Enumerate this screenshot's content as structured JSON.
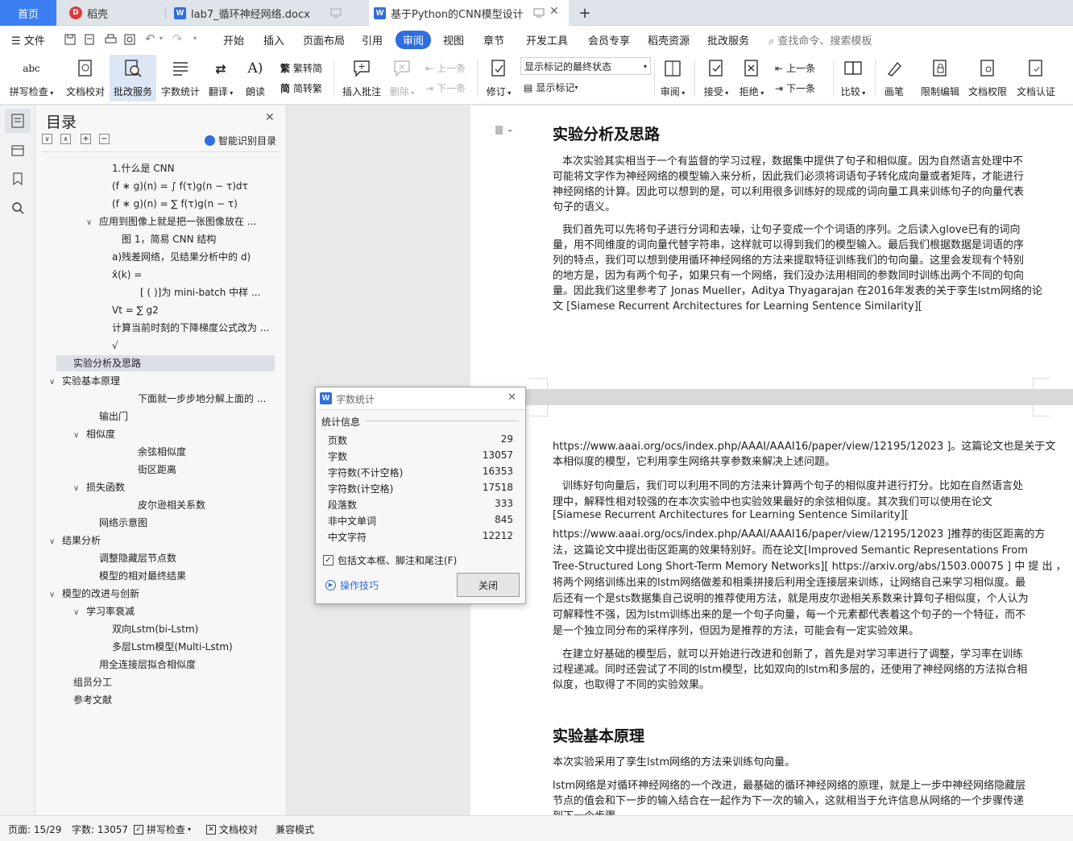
{
  "tabs": {
    "home": "首页",
    "daoke": "稻壳",
    "doc1": "lab7_循环神经网络.docx",
    "doc2": "基于Python的CNN模型设计",
    "add": "+"
  },
  "menu": {
    "file": "文件",
    "items": [
      "开始",
      "插入",
      "页面布局",
      "引用",
      "审阅",
      "视图",
      "章节",
      "开发工具",
      "会员专享",
      "稻壳资源",
      "批改服务"
    ],
    "active": "审阅",
    "search": "查找命令、搜索模板"
  },
  "toolbar": {
    "spell": "拼写检查",
    "proof": "文档校对",
    "grade": "批改服务",
    "count": "字数统计",
    "translate": "翻译",
    "read": "朗读",
    "to_trad": "繁转简",
    "to_simp": "简转繁",
    "insert_comment": "插入批注",
    "delete": "删除",
    "prev_comment": "上一条",
    "next_comment": "下一条",
    "revise": "修订",
    "markup_state": "显示标记的最终状态",
    "show_markup": "显示标记",
    "review": "审阅",
    "accept": "接受",
    "reject": "拒绝",
    "prev_change": "上一条",
    "next_change": "下一条",
    "compare": "比较",
    "pen": "画笔",
    "restrict": "限制编辑",
    "doc_perm": "文档权限",
    "doc_cert": "文档认证",
    "ic_abc": "abc"
  },
  "nav": {
    "title": "目录",
    "smart": "智能识别目录",
    "items": [
      {
        "text": "1.什么是 CNN",
        "arrow": ""
      },
      {
        "text": "(f ∗ g)(n) = ∫ f(τ)g(n − τ)dτ",
        "arrow": ""
      },
      {
        "text": "(f ∗ g)(n) = ∑ f(τ)g(n − τ)",
        "arrow": ""
      },
      {
        "text": "应用到图像上就是把一张图像放在 ...",
        "arrow": "∨"
      },
      {
        "text": "图 1，简易 CNN 结构",
        "arrow": ""
      },
      {
        "text": "a)残差网络，见结果分析中的 d)",
        "arrow": ""
      },
      {
        "text": "x̂(k) =",
        "arrow": ""
      },
      {
        "text": "[  (   )]为 mini-batch 中样 ...",
        "arrow": ""
      },
      {
        "text": "Vt  = ∑ g2",
        "arrow": ""
      },
      {
        "text": "计算当前时刻的下降梯度公式改为 ...",
        "arrow": ""
      },
      {
        "text": "√",
        "arrow": ""
      },
      {
        "text": "实验分析及思路",
        "arrow": ""
      },
      {
        "text": "实验基本原理",
        "arrow": "∨"
      },
      {
        "text": "下面就一步步地分解上面的 ...",
        "arrow": ""
      },
      {
        "text": "输出门",
        "arrow": ""
      },
      {
        "text": "相似度",
        "arrow": "∨"
      },
      {
        "text": "余弦相似度",
        "arrow": ""
      },
      {
        "text": "街区距离",
        "arrow": ""
      },
      {
        "text": "损失函数",
        "arrow": "∨"
      },
      {
        "text": "皮尔逊相关系数",
        "arrow": ""
      },
      {
        "text": "网络示意图",
        "arrow": ""
      },
      {
        "text": "结果分析",
        "arrow": "∨"
      },
      {
        "text": "调整隐藏层节点数",
        "arrow": ""
      },
      {
        "text": "模型的相对最终结果",
        "arrow": ""
      },
      {
        "text": "模型的改进与创新",
        "arrow": "∨"
      },
      {
        "text": "学习率衰减",
        "arrow": "∨"
      },
      {
        "text": "双向Lstm(bi-Lstm)",
        "arrow": ""
      },
      {
        "text": "多层Lstm模型(Multi-Lstm)",
        "arrow": ""
      },
      {
        "text": "用全连接层拟合相似度",
        "arrow": ""
      },
      {
        "text": "组员分工",
        "arrow": ""
      },
      {
        "text": "参考文献",
        "arrow": ""
      }
    ]
  },
  "doc": {
    "h1": "实验分析及思路",
    "p1": [
      "本次实验其实相当于一个有监督的学习过程，数据集中提供了句子和相似度。因为自然语言处理中不",
      "可能将文字作为神经网络的模型输入来分析，因此我们必须将词语句子转化成向量或者矩阵，才能进行",
      "神经网络的计算。因此可以想到的是，可以利用很多训练好的现成的词向量工具来训练句子的向量代表",
      "句子的语义。"
    ],
    "p2": [
      "我们首先可以先将句子进行分词和去噪，让句子变成一个个词语的序列。之后读入glove已有的词向",
      "量，用不同维度的词向量代替字符串，这样就可以得到我们的模型输入。最后我们根据数据是词语的序",
      "列的特点，我们可以想到使用循环神经网络的方法来提取特征训练我们的句向量。这里会发现有个特别",
      "的地方是，因为有两个句子，如果只有一个网络，我们没办法用相同的参数同时训练出两个不同的句向",
      "量。因此我们这里参考了 Jonas Mueller，Aditya Thyagarajan 在2016年发表的关于孪生lstm网络的论",
      "文 [Siamese Recurrent Architectures for Learning Sentence Similarity]["
    ],
    "p3": [
      "https://www.aaai.org/ocs/index.php/AAAI/AAAI16/paper/view/12195/12023      ]。这篇论文也是关于文",
      "本相似度的模型，它利用孪生网络共享参数来解决上述问题。"
    ],
    "p4": [
      "训练好句向量后，我们可以利用不同的方法来计算两个句子的相似度并进行打分。比如在自然语言处",
      "理中，解释性相对较强的在本次实验中也实验效果最好的余弦相似度。其次我们可以使用在论文",
      "[Siamese Recurrent Architectures for Learning Sentence Similarity][",
      "https://www.aaai.org/ocs/index.php/AAAI/AAAI16/paper/view/12195/12023       ]推荐的街区距离的方",
      "法，这篇论文中提出街区距离的效果特别好。而在论文[Improved  Semantic  Representations  From",
      "Tree-Structured  Long  Short-Term  Memory  Networks][   https://arxiv.org/abs/1503.00075  ] 中 提 出 ，",
      "将两个网络训练出来的lstm网络做差和相乘拼接后利用全连接层来训练，让网络自己来学习相似度。最",
      "后还有一个是sts数据集自己说明的推荐使用方法，就是用皮尔逊相关系数来计算句子相似度，个人认为",
      "可解释性不强，因为lstm训练出来的是一个句子向量，每一个元素都代表着这个句子的一个特征，而不",
      "是一个独立同分布的采样序列，但因为是推荐的方法，可能会有一定实验效果。"
    ],
    "p5": [
      "在建立好基础的模型后，就可以开始进行改进和创新了，首先是对学习率进行了调整，学习率在训练",
      "过程递减。同时还尝试了不同的lstm模型，比如双向的lstm和多层的，还使用了神经网络的方法拟合相",
      "似度，也取得了不同的实验效果。"
    ],
    "h2": "实验基本原理",
    "p6": "本次实验采用了孪生lstm网络的方法来训练句向量。",
    "p7": [
      "lstm网络是对循环神经网络的一个改进，最基础的循环神经网络的原理，就是上一步中神经网络隐藏层",
      "节点的值会和下一步的输入结合在一起作为下一次的输入，这就相当于允许信息从网络的一个步骤传递",
      "到下一个步骤"
    ]
  },
  "dialog": {
    "title": "字数统计",
    "section": "统计信息",
    "rows": [
      [
        "页数",
        "29"
      ],
      [
        "字数",
        "13057"
      ],
      [
        "字符数(不计空格)",
        "16353"
      ],
      [
        "字符数(计空格)",
        "17518"
      ],
      [
        "段落数",
        "333"
      ],
      [
        "非中文单词",
        "845"
      ],
      [
        "中文字符",
        "12212"
      ]
    ],
    "checkbox": "包括文本框、脚注和尾注(F)",
    "tips": "操作技巧",
    "close": "关闭"
  },
  "status": {
    "page": "页面: 15/29",
    "words": "字数: 13057",
    "spell": "拼写检查",
    "proof": "文档校对",
    "compat": "兼容模式"
  },
  "colors": {
    "accent": "#2f6de1",
    "home_tab": "#3b7ff3"
  }
}
